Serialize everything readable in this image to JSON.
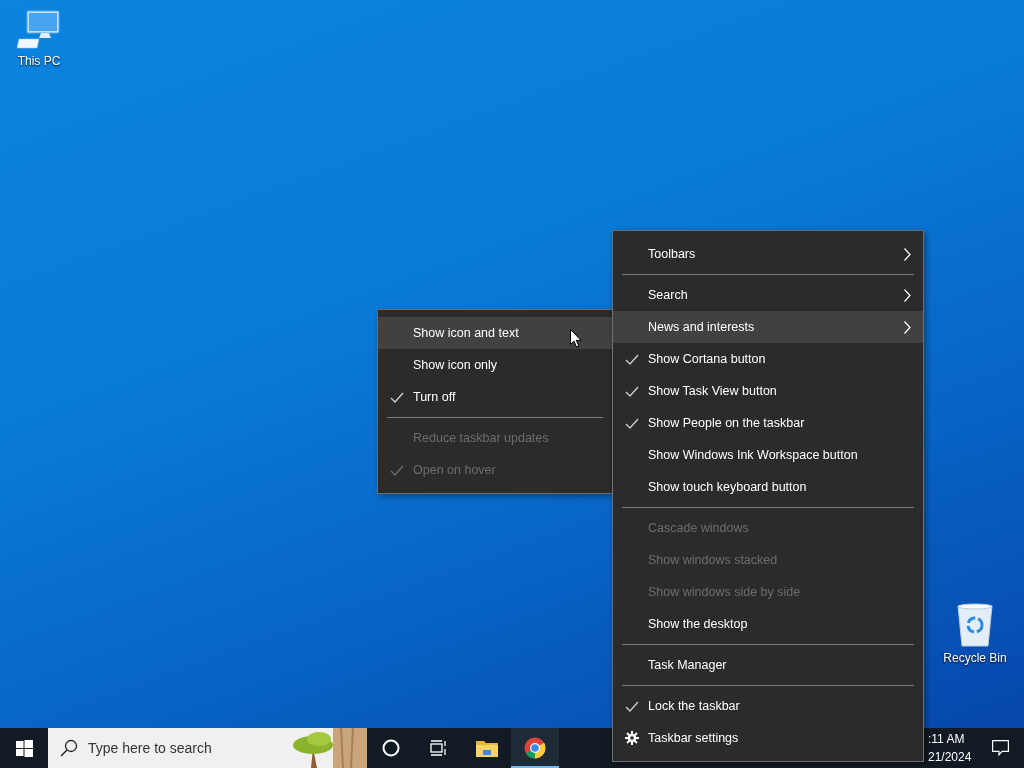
{
  "desktop_icons": [
    {
      "label": "This PC",
      "kind": "computer"
    },
    {
      "label": "Recycle Bin",
      "kind": "recycle-bin"
    }
  ],
  "submenu": {
    "items": [
      {
        "kind": "item",
        "label": "Show icon and text",
        "checked": false,
        "disabled": false,
        "selected": true
      },
      {
        "kind": "item",
        "label": "Show icon only",
        "checked": false,
        "disabled": false,
        "selected": false
      },
      {
        "kind": "item",
        "label": "Turn off",
        "checked": true,
        "disabled": false,
        "selected": false
      },
      {
        "kind": "separator"
      },
      {
        "kind": "item",
        "label": "Reduce taskbar updates",
        "checked": false,
        "disabled": true,
        "selected": false
      },
      {
        "kind": "item",
        "label": "Open on hover",
        "checked": true,
        "disabled": true,
        "selected": false
      }
    ]
  },
  "context_menu": {
    "items": [
      {
        "kind": "submenu",
        "label": "Toolbars",
        "checked": false,
        "disabled": false,
        "selected": false
      },
      {
        "kind": "separator"
      },
      {
        "kind": "submenu",
        "label": "Search",
        "checked": false,
        "disabled": false,
        "selected": false
      },
      {
        "kind": "submenu",
        "label": "News and interests",
        "checked": false,
        "disabled": false,
        "selected": true
      },
      {
        "kind": "item",
        "label": "Show Cortana button",
        "checked": true,
        "disabled": false,
        "selected": false
      },
      {
        "kind": "item",
        "label": "Show Task View button",
        "checked": true,
        "disabled": false,
        "selected": false
      },
      {
        "kind": "item",
        "label": "Show People on the taskbar",
        "checked": true,
        "disabled": false,
        "selected": false
      },
      {
        "kind": "item",
        "label": "Show Windows Ink Workspace button",
        "checked": false,
        "disabled": false,
        "selected": false
      },
      {
        "kind": "item",
        "label": "Show touch keyboard button",
        "checked": false,
        "disabled": false,
        "selected": false
      },
      {
        "kind": "separator"
      },
      {
        "kind": "item",
        "label": "Cascade windows",
        "checked": false,
        "disabled": true,
        "selected": false
      },
      {
        "kind": "item",
        "label": "Show windows stacked",
        "checked": false,
        "disabled": true,
        "selected": false
      },
      {
        "kind": "item",
        "label": "Show windows side by side",
        "checked": false,
        "disabled": true,
        "selected": false
      },
      {
        "kind": "item",
        "label": "Show the desktop",
        "checked": false,
        "disabled": false,
        "selected": false
      },
      {
        "kind": "separator"
      },
      {
        "kind": "item",
        "label": "Task Manager",
        "checked": false,
        "disabled": false,
        "selected": false
      },
      {
        "kind": "separator"
      },
      {
        "kind": "item",
        "label": "Lock the taskbar",
        "checked": true,
        "disabled": false,
        "selected": false
      },
      {
        "kind": "settings",
        "label": "Taskbar settings",
        "disabled": false,
        "selected": false
      }
    ]
  },
  "taskbar": {
    "search": {
      "placeholder": "Type here to search"
    },
    "buttons": [
      {
        "kind": "cortana",
        "running": false
      },
      {
        "kind": "task-view",
        "running": false
      },
      {
        "kind": "file-explorer",
        "running": false
      },
      {
        "kind": "browser",
        "running": true
      }
    ],
    "clock": {
      "time": ":11 AM",
      "date": "21/2024"
    }
  }
}
